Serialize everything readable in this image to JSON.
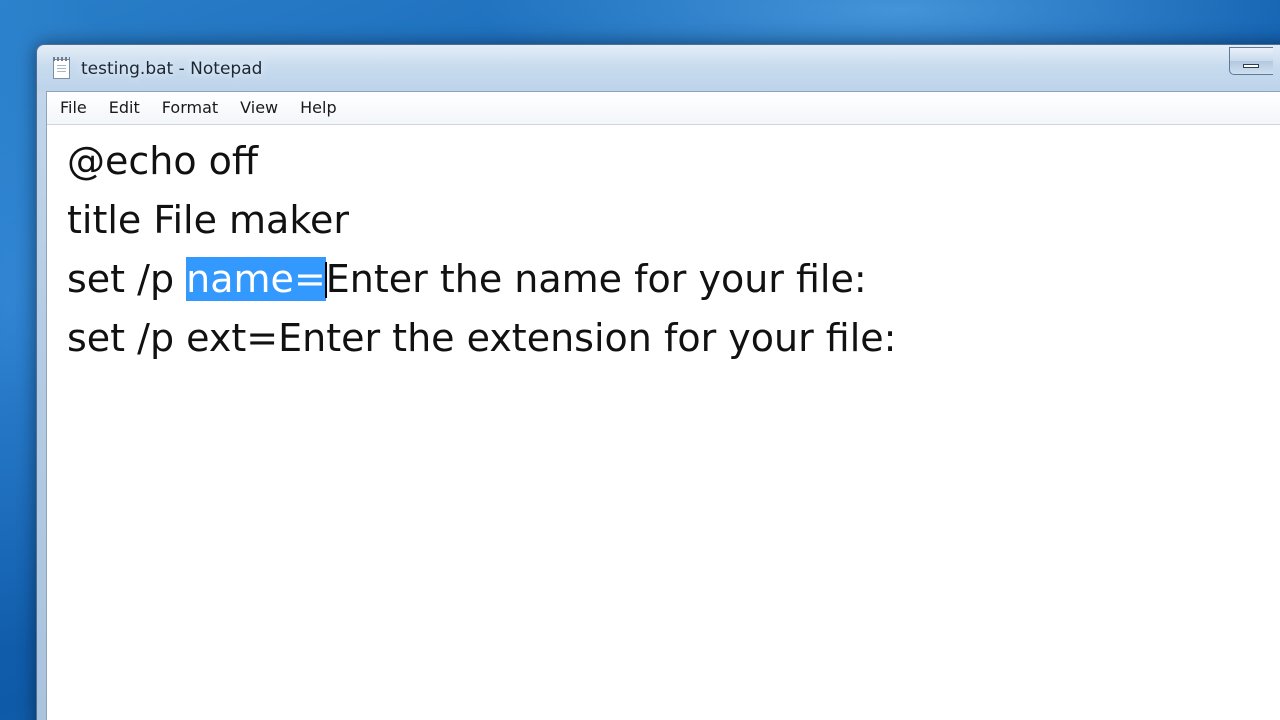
{
  "window": {
    "title": "testing.bat - Notepad"
  },
  "menubar": {
    "items": [
      {
        "label": "File"
      },
      {
        "label": "Edit"
      },
      {
        "label": "Format"
      },
      {
        "label": "View"
      },
      {
        "label": "Help"
      }
    ]
  },
  "editor": {
    "lines": [
      {
        "text": "@echo off"
      },
      {
        "text": "title File maker"
      },
      {
        "before": "set /p ",
        "selected": "name=",
        "after": "Enter the name for your file:"
      },
      {
        "text": "set /p ext=Enter the extension for your file:"
      }
    ]
  },
  "colors": {
    "selection": "#3399ff",
    "desktop": "#1565b5"
  }
}
